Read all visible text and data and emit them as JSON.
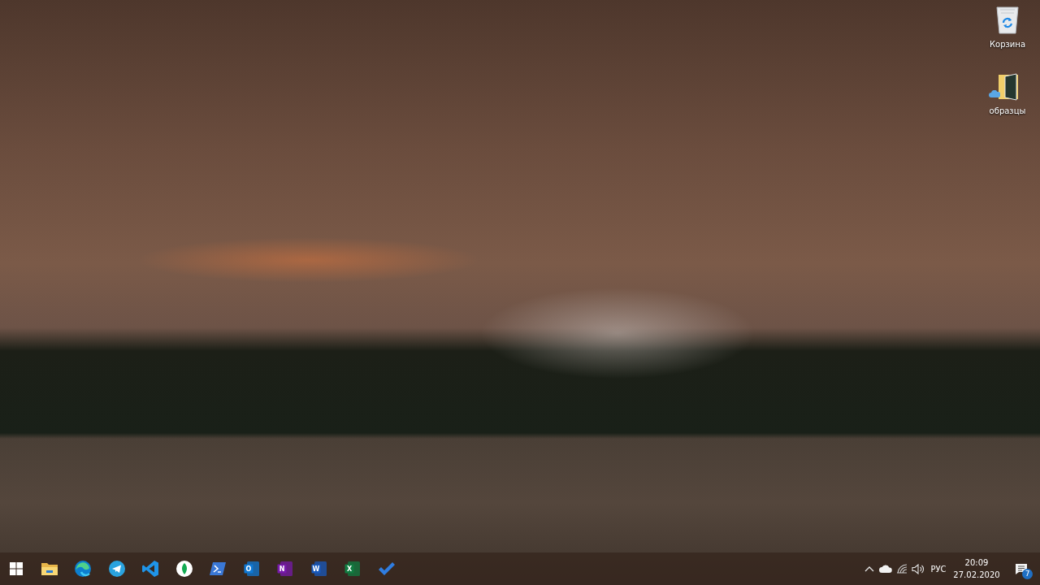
{
  "desktop_icons": [
    {
      "kind": "recycle_bin",
      "label": "Корзина",
      "synced": false
    },
    {
      "kind": "folder",
      "label": "образцы",
      "synced": true
    }
  ],
  "taskbar": {
    "apps": [
      {
        "kind": "start"
      },
      {
        "kind": "folder"
      },
      {
        "kind": "swirl"
      },
      {
        "kind": "paper_plane"
      },
      {
        "kind": "angle"
      },
      {
        "kind": "leaf"
      },
      {
        "kind": "prompt"
      },
      {
        "kind": "tile",
        "letter": "O",
        "color": "#0f78d4"
      },
      {
        "kind": "tile",
        "letter": "N",
        "color": "#7719aa"
      },
      {
        "kind": "tile",
        "letter": "W",
        "color": "#185abd"
      },
      {
        "kind": "tile",
        "letter": "X",
        "color": "#107c41"
      },
      {
        "kind": "check"
      }
    ],
    "tray": {
      "language": "РУС",
      "time": "20:09",
      "date": "27.02.2020",
      "notification_count": "7"
    }
  }
}
